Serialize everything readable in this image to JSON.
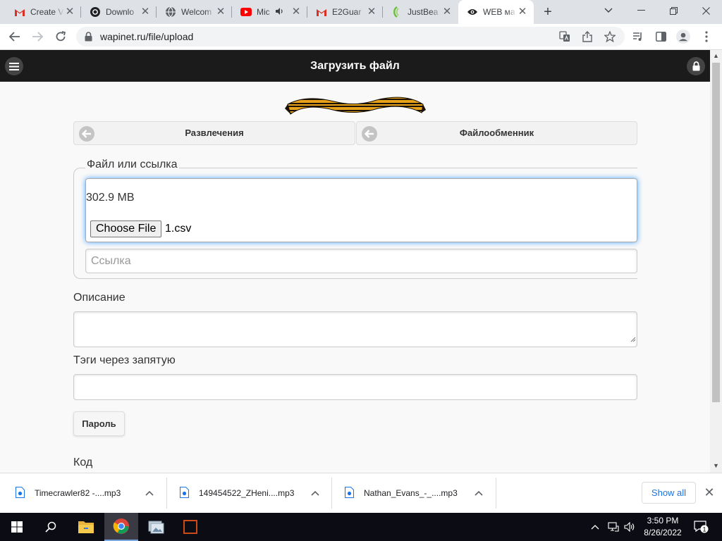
{
  "browser": {
    "tabs": [
      {
        "title": "Create V",
        "icon": "gmail-icon"
      },
      {
        "title": "Downlo",
        "icon": "openai-icon"
      },
      {
        "title": "Welcom",
        "icon": "globe-icon"
      },
      {
        "title": "Mic",
        "icon": "youtube-icon"
      },
      {
        "title": "E2Guar",
        "icon": "gmail-icon"
      },
      {
        "title": "JustBea",
        "icon": "justbeamit-icon"
      },
      {
        "title": "WEB ма",
        "icon": "eye-icon"
      }
    ],
    "active_tab": 6,
    "url": "wapinet.ru/file/upload"
  },
  "header": {
    "title": "Загрузить файл"
  },
  "nav": {
    "left_label": "Развлечения",
    "right_label": "Файлообменник"
  },
  "form": {
    "file_legend": "Файл или ссылка",
    "file_size": "302.9 MB",
    "choose_button": "Choose File",
    "file_name": "1.csv",
    "link_placeholder": "Ссылка",
    "description_label": "Описание",
    "tags_label": "Тэги через запятую",
    "password_button": "Пароль",
    "code_label": "Код"
  },
  "downloads": {
    "items": [
      {
        "name": "Timecrawler82 -....mp3"
      },
      {
        "name": "149454522_ZHeni....mp3"
      },
      {
        "name": "Nathan_Evans_-_....mp3"
      }
    ],
    "show_all": "Show all"
  },
  "taskbar": {
    "time": "3:50 PM",
    "date": "8/26/2022",
    "notification_count": "1"
  },
  "colors": {
    "header_bg": "#1b1b1b",
    "focus_glow": "#4da6ff",
    "link_blue": "#1a73e8"
  }
}
